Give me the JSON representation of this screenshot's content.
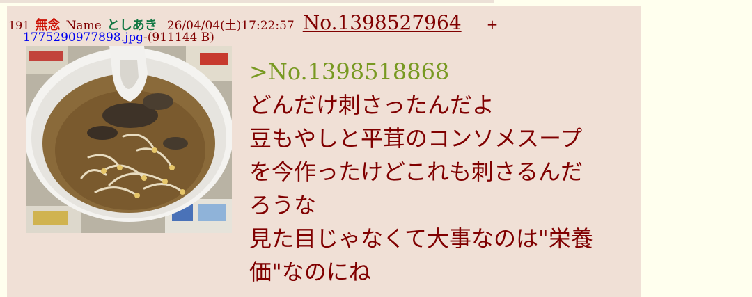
{
  "post": {
    "index": "191",
    "subject": "無念",
    "name_label": "Name",
    "name": "としあき",
    "datetime": "26/04/04(土)17:22:57",
    "number": "No.1398527964",
    "plus": "+",
    "file": {
      "filename": "1775290977898.jpg",
      "separator": "-",
      "size": "(911144 B)"
    },
    "thumbnail_icon": "soup-photo",
    "quote": ">No.1398518868",
    "lines": [
      "どんだけ刺さったんだよ",
      "豆もやしと平茸のコンソメスープ",
      "を今作ったけどこれも刺さるんだ",
      "ろうな",
      "見た目じゃなくて大事なのは\"栄養",
      "価\"なのにね"
    ]
  },
  "colors": {
    "page_bg": "#ffffee",
    "post_bg": "#f0e0d6",
    "text": "#800000",
    "subject": "#cc1105",
    "name": "#117743",
    "quote": "#789922",
    "link": "#0000ee"
  }
}
